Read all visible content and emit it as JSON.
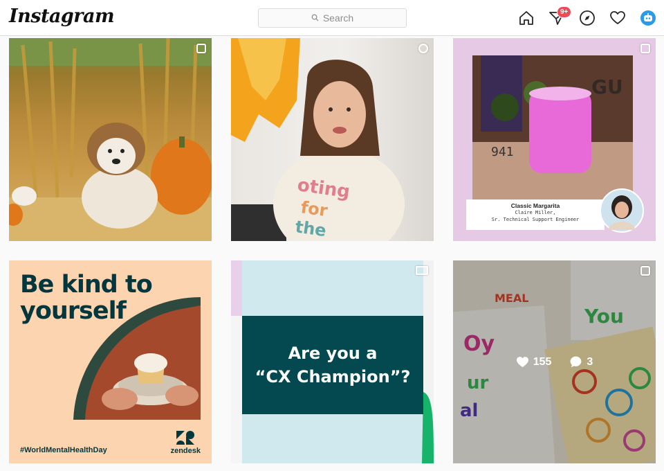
{
  "header": {
    "logo_text": "Instagram",
    "search_placeholder": "Search",
    "notification_badge": "9+",
    "icons": [
      "home-icon",
      "direct-message-icon",
      "explore-compass-icon",
      "activity-heart-icon",
      "profile-avatar-icon"
    ]
  },
  "posts": [
    {
      "type": "multi-image",
      "scene": "dog-pumpkin-patch"
    },
    {
      "type": "video",
      "scene": "woman-voting-shirt"
    },
    {
      "type": "multi-image",
      "caption_title": "Classic Margarita",
      "caption_name": "Claire Miller,",
      "caption_role": "Sr. Technical Support Engineer"
    },
    {
      "type": "image",
      "headline_line1": "Be kind to",
      "headline_line2": "yourself",
      "hashtag": "#WorldMentalHealthDay",
      "brand": "zendesk"
    },
    {
      "type": "video",
      "headline_line1": "Are you a",
      "headline_line2": "“CX Champion”?"
    },
    {
      "type": "multi-image",
      "hover": {
        "likes": "155",
        "comments": "3"
      }
    }
  ],
  "colors": {
    "brand_dark": "#03363d",
    "badge_red": "#ed4956",
    "avatar_blue": "#2a9be8"
  }
}
